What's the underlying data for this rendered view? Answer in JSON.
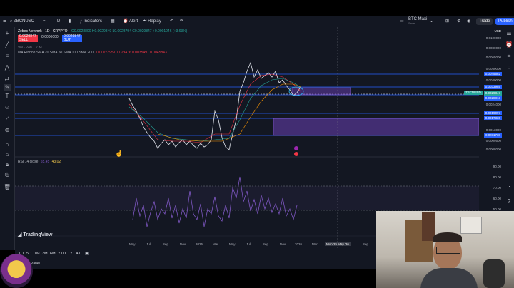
{
  "topbar": {
    "symbol": "ZBCNUSC",
    "interval": "D",
    "indicators_label": "Indicators",
    "alert_label": "Alert",
    "replay_label": "Replay",
    "layout_name": "BTC Maxi",
    "layout_sub": "Save",
    "trade_label": "Trade",
    "publish_label": "Publish"
  },
  "chart": {
    "title": "Zebec Network · 1D · CRYPTO",
    "ohlc": "O0.0028800 H0.0029849 L0.0028794 C0.0029847 +0.0001046 (+3.63%)",
    "sell_price": "0.0029847",
    "sell_label": "SELL",
    "spread": "0.0000000",
    "buy_price": "0.0029847",
    "buy_label": "BUY",
    "vol_label": "Vol · 24h 1.7 M",
    "ma_ribbon": "MA Ribbon SMA 20 SMA 50 SMA 100 SMA 200",
    "ma_values": "0.0027395  0.0029476  0.0035497  0.0045843",
    "rsi_label": "RSI 14 close",
    "rsi_value_1": "55.45",
    "rsi_value_2": "43.02",
    "watermark": "TradingView",
    "currency": "USD",
    "colors": {
      "bg": "#131722",
      "candle": "#d1d4dc",
      "level": "#2962ff",
      "zone": "#6a3fb5",
      "rsi": "#7e57c2",
      "sma_red": "#f23645",
      "sma_green": "#26a69a"
    }
  },
  "price_scale": {
    "labels": [
      "0.0100000",
      "0.0080000",
      "0.0065000",
      "0.0050000",
      "0.0040000",
      "0.0030000",
      "0.0024000",
      "0.0019000",
      "0.0015000",
      "0.0013000",
      "0.0011000",
      "0.0009500",
      "0.0008000"
    ],
    "tags": [
      {
        "text": "0.0045582",
        "color": "#2962ff"
      },
      {
        "text": "0.0033985",
        "color": "#2962ff"
      },
      {
        "text": "0.0029847",
        "color": "#26a69a"
      },
      {
        "text": "0.0028813",
        "color": "#2962ff"
      },
      {
        "text": "0.0019097",
        "color": "#2962ff"
      },
      {
        "text": "0.0017330",
        "color": "#2962ff"
      },
      {
        "text": "0.0011738",
        "color": "#2962ff"
      }
    ],
    "symbol_tag": "ZBCNUSD",
    "rsi_labels": [
      "90.00",
      "80.00",
      "70.00",
      "60.00",
      "50.00",
      "40.00"
    ]
  },
  "time_axis": [
    "May",
    "Jul",
    "Sep",
    "Nov",
    "2025",
    "Mar",
    "May",
    "Jul",
    "Sep",
    "Nov",
    "2026",
    "Mar",
    "Mon 25 May '26",
    "Sep"
  ],
  "timeframes": [
    "1D",
    "5D",
    "1M",
    "3M",
    "6M",
    "YTD",
    "1Y",
    "All"
  ],
  "bottom": {
    "panel_label": "Panel"
  }
}
